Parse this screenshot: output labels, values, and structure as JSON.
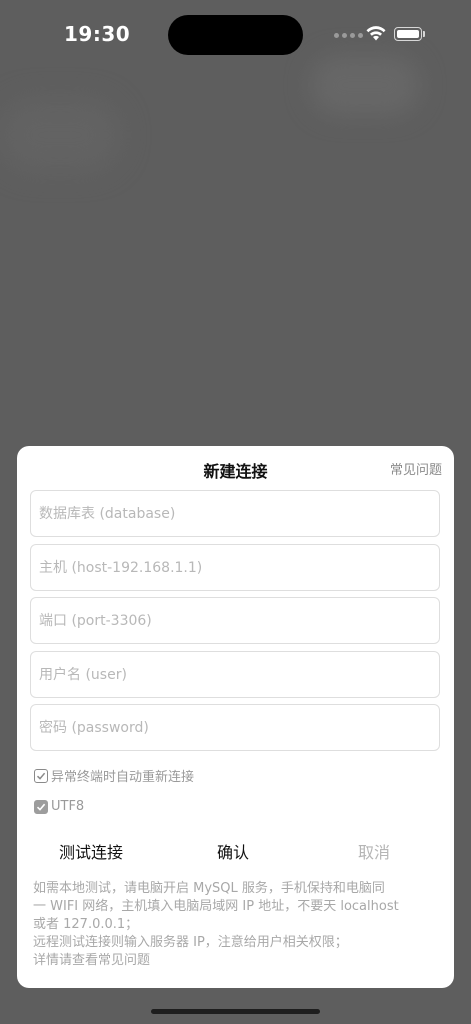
{
  "status_bar": {
    "time": "19:30"
  },
  "dialog": {
    "title": "新建连接",
    "faq_link": "常见问题",
    "fields": {
      "database_placeholder": "数据库表 (database)",
      "host_placeholder": "主机 (host-192.168.1.1)",
      "port_placeholder": "端口 (port-3306)",
      "user_placeholder": "用户名 (user)",
      "password_placeholder": "密码 (password)"
    },
    "checkboxes": {
      "reconnect_label": "异常终端时自动重新连接",
      "reconnect_checked": true,
      "utf8_label": "UTF8",
      "utf8_checked": true
    },
    "buttons": {
      "test": "测试连接",
      "confirm": "确认",
      "cancel": "取消"
    },
    "help_lines": [
      "如需本地测试，请电脑开启 MySQL 服务，手机保持和电脑同",
      "一 WIFI 网络，主机填入电脑局域网 IP 地址，不要天 localhost",
      "或者 127.0.0.1；",
      "远程测试连接则输入服务器 IP，注意给用户相关权限；",
      "详情请查看常见问题"
    ]
  },
  "icons": {
    "wifi": "wifi-icon",
    "battery": "battery-icon",
    "signal": "cellular-signal-icon",
    "check": "checkmark-icon"
  }
}
